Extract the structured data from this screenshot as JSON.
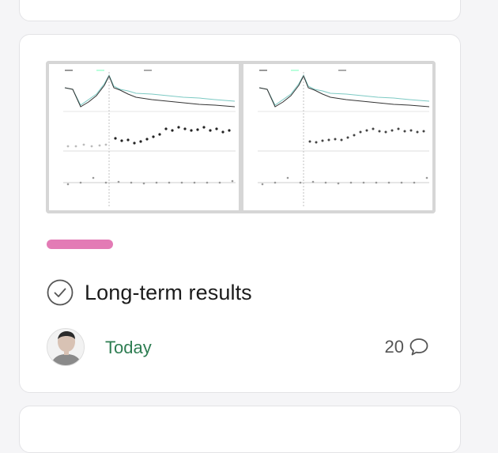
{
  "colors": {
    "tag": "#e37bb5",
    "date": "#2e7d52",
    "check": "#555555",
    "chat": "#555555"
  },
  "card": {
    "thumbnail_icon": "results-chart-thumbnail",
    "title": "Long-term results",
    "status_icon": "check-circle-icon",
    "date": "Today",
    "comment_count": "20",
    "comment_icon": "chat-bubble-icon",
    "avatar_icon": "user-avatar-icon"
  }
}
